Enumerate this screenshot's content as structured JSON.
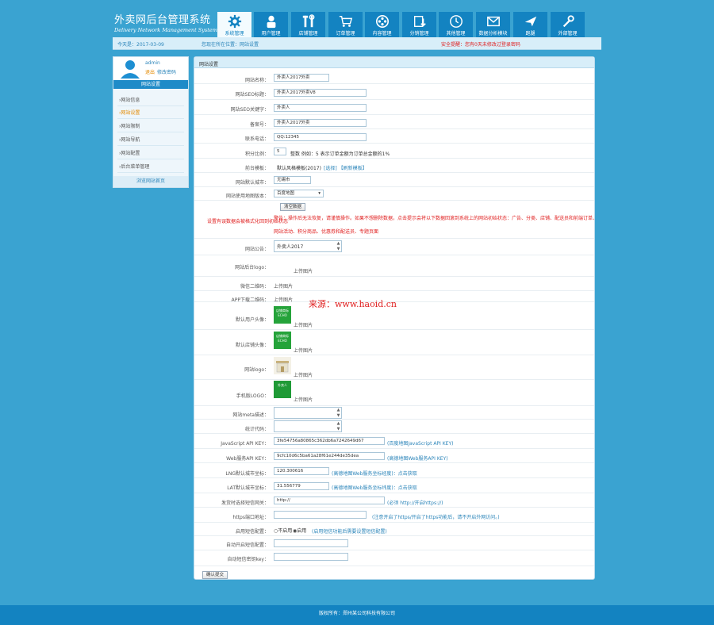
{
  "header": {
    "title_cn": "外卖网后台管理系统",
    "title_en": "Delivery Network Management System",
    "nav": [
      {
        "label": "系统管理",
        "icon": "gear-icon",
        "active": true
      },
      {
        "label": "用户管理",
        "icon": "user-icon"
      },
      {
        "label": "店铺管理",
        "icon": "tools-icon"
      },
      {
        "label": "订单管理",
        "icon": "cart-icon"
      },
      {
        "label": "内容管理",
        "icon": "film-reel-icon"
      },
      {
        "label": "分销管理",
        "icon": "download-icon"
      },
      {
        "label": "其他管理",
        "icon": "clock-icon"
      },
      {
        "label": "数据分析模块",
        "icon": "mail-icon"
      },
      {
        "label": "跑腿",
        "icon": "plane-icon"
      },
      {
        "label": "外部管理",
        "icon": "wrench-icon"
      }
    ]
  },
  "topbar": {
    "date": "今天是：2017-03-09",
    "location": "您现在所在位置：网站设置",
    "warning": "安全提醒：您有0天未修改过登录密码"
  },
  "sidebar": {
    "username": "admin",
    "link_exit": "退出",
    "link_pwd": "修改密码",
    "title": "网站设置",
    "items": [
      "网站信息",
      "网站设置",
      "网站限制",
      "网站导航",
      "网站配置",
      "后台菜单管理"
    ],
    "active_index": 1,
    "bottom": "浏览网站首页"
  },
  "main": {
    "title": "网站设置",
    "site_name_label": "网站名称：",
    "site_name": "外卖人2017外卖",
    "seo_title_label": "网站SEO标题：",
    "seo_title": "外卖人2017外卖V8",
    "seo_kw_label": "网站SEO关键字：",
    "seo_kw": "外卖人",
    "icp_label": "备案号：",
    "icp": "外卖人2017外卖",
    "phone_label": "联系电话：",
    "phone": "QQ:12345",
    "ratio_label": "积分比例：",
    "ratio": "5",
    "ratio_note": "整数 例如：5 表示订单金额为订单总金额的1%",
    "tpl_label": "前台模板：",
    "tpl_value": "默认风格模板(2017)",
    "tpl_links": "[选择] 【刷新模板】",
    "city_label": "网站默认城市：",
    "city": "无锡市",
    "map_label": "网站使用地图版本：",
    "map_select": "百度地图",
    "clear_btn": "清空数据",
    "clear_left": "设置有误数据会被格式化回到初始状态",
    "clear_warn1": "警告：操作后无法恢复，请谨慎操作。如果不想删除数据，点击提示会将以下数据回滚到系统上的网站初始状态：广告、分类、店铺、配送员和前端订单、",
    "clear_warn2": "网站活动、积分商品、优惠券和配送员、专题页面",
    "notice_label": "网站公告：",
    "notice": "外卖人2017",
    "logo_label": "网站后台logo：",
    "logo_upload": "上传图片",
    "wx_label": "微信二维码：",
    "wx_upload": "上传图片",
    "app_label": "APP下载二维码：",
    "app_upload": "上传图片",
    "avatar_label": "默认用户头像：",
    "avatar_upload": "上传图片",
    "shop_label": "默认店铺头像：",
    "shop_upload": "上传图片",
    "sitelogo_label": "网站logo：",
    "sitelogo_upload": "上传图片",
    "mlogo_label": "手机版LOGO：",
    "mlogo_upload": "上传图片",
    "thumb_text1": "店铺商标",
    "thumb_text2": "ECHO",
    "thumb_text3": "外卖人",
    "meta_label": "网站meta描述：",
    "stat_label": "统计代码：",
    "jskey_label": "JavaScript API KEY：",
    "jskey": "3fe54756a80865c362db6a7242649d67",
    "jskey_note": "(百度地图JavaScript API KEY)",
    "webkey_label": "Web服务API KEY：",
    "webkey": "9cfc10d6c5ba61a28f61e244de35dea",
    "webkey_note": "(高德地图Web服务API KEY)",
    "lng_label": "LNG默认城市坐标：",
    "lng": "120.300616",
    "lng_note": "(高德地图Web服务坐标经度)：点击获取",
    "lat_label": "LAT默认城市坐标：",
    "lat": "31.556779",
    "lat_note": "(高德地图Web服务坐标纬度)：点击获取",
    "https_label": "发货时选择短信网关：",
    "https_val": "http://",
    "https_note": "(必须 http://开启https://)",
    "httpsport_label": "https端口地址：",
    "httpsport_note": "(注意开启了https/开启了https功能后，请不开启外网访问。)",
    "switch_label": "启用短信配置：",
    "switch_opt1": "不启用",
    "switch_opt2": "启用",
    "switch_note": "(启用短信功能后需要设置短信配置)",
    "open_label": "自动开启短信配置：",
    "key_label": "自动短信密钥key：",
    "submit": "确认提交"
  },
  "watermark": "来源：www.haoid.cn",
  "footer": "版权所有：郑州某公司科技有限公司"
}
